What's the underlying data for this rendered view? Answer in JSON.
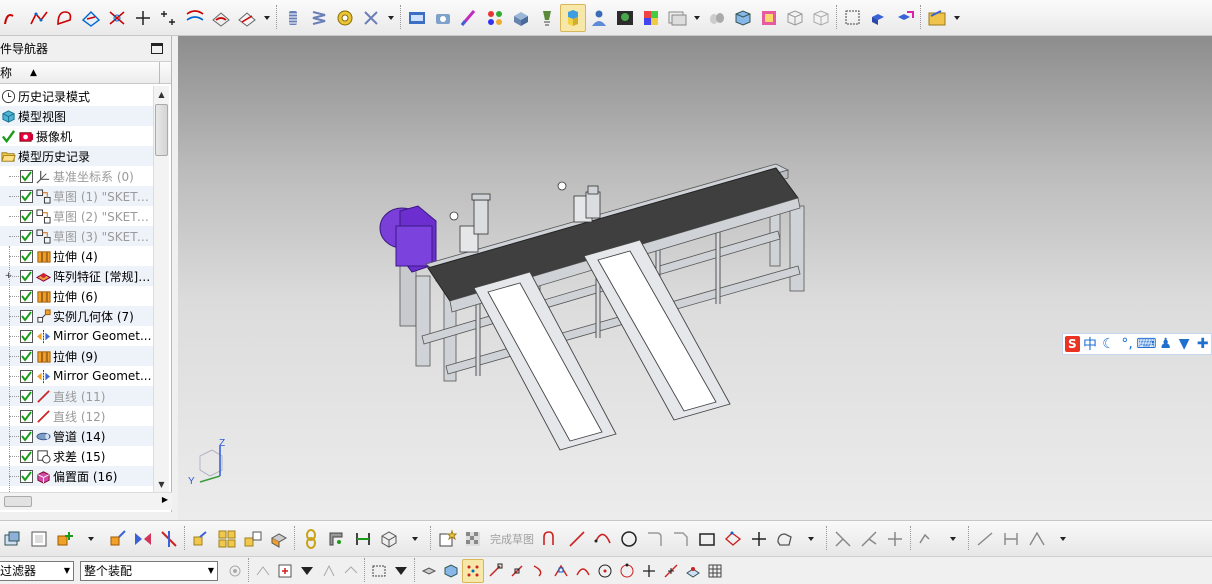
{
  "navigator": {
    "title": "部件导航器",
    "column_name": "名称",
    "items": [
      {
        "label": "历史记录模式",
        "icon": "clock-icon",
        "gray": false
      },
      {
        "label": "模型视图",
        "icon": "model-views-icon",
        "gray": false
      },
      {
        "label": "摄像机",
        "icon": "camera-icon",
        "gray": false
      },
      {
        "label": "模型历史记录",
        "icon": "folder-open-icon",
        "gray": false
      },
      {
        "label": "基准坐标系 (0)",
        "icon": "datum-csys-icon",
        "gray": true
      },
      {
        "label": "草图 (1) \"SKETC...",
        "icon": "sketch-icon",
        "gray": true
      },
      {
        "label": "草图 (2) \"SKETC...",
        "icon": "sketch-icon",
        "gray": true
      },
      {
        "label": "草图 (3) \"SKETC...",
        "icon": "sketch-icon",
        "gray": true
      },
      {
        "label": "拉伸 (4)",
        "icon": "extrude-icon",
        "gray": false
      },
      {
        "label": "阵列特征 [常规] ...",
        "icon": "pattern-feature-icon",
        "gray": false
      },
      {
        "label": "拉伸 (6)",
        "icon": "extrude-icon",
        "gray": false
      },
      {
        "label": "实例几何体 (7)",
        "icon": "instance-geometry-icon",
        "gray": false
      },
      {
        "label": "Mirror Geomet...",
        "icon": "mirror-geometry-icon",
        "gray": false
      },
      {
        "label": "拉伸 (9)",
        "icon": "extrude-icon",
        "gray": false
      },
      {
        "label": "Mirror Geomet...",
        "icon": "mirror-geometry-icon",
        "gray": false
      },
      {
        "label": "直线 (11)",
        "icon": "line-icon",
        "gray": true
      },
      {
        "label": "直线 (12)",
        "icon": "line-icon",
        "gray": true
      },
      {
        "label": "管道 (14)",
        "icon": "tube-icon",
        "gray": false
      },
      {
        "label": "求差 (15)",
        "icon": "subtract-icon",
        "gray": false
      },
      {
        "label": "偏置面 (16)",
        "icon": "offset-face-icon",
        "gray": false
      }
    ]
  },
  "bottom_toolbar": {
    "finish_sketch_label": "完成草图"
  },
  "filter_bar": {
    "type_filter": "过滤器",
    "scope_filter": "整个装配"
  },
  "ime": {
    "logo": "S",
    "mode": "中"
  },
  "triad": {
    "z": "Z",
    "y": "Y"
  },
  "colors": {
    "motor": "#7b3fd9",
    "belt": "#3f3f3f",
    "frame": "#cfd2d6",
    "checkmark": "#1a9c1a"
  }
}
